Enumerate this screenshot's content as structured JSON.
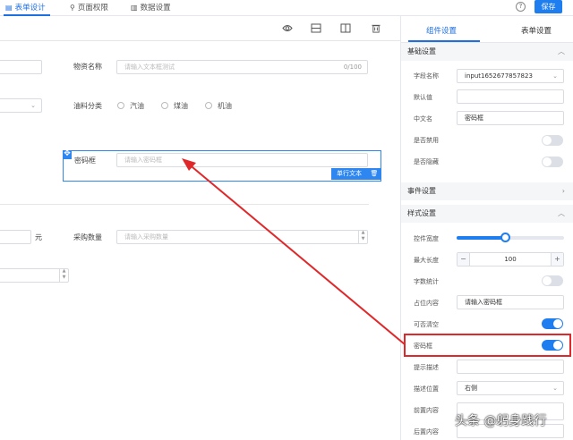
{
  "topbar": {
    "tabs": [
      {
        "label": "表单设计",
        "icon": "document-icon"
      },
      {
        "label": "页面权限",
        "icon": "lock-icon"
      },
      {
        "label": "数据设置",
        "icon": "chart-icon"
      }
    ],
    "help_icon": "?",
    "save_label": "保存"
  },
  "canvas": {
    "toolbar_icons": [
      "eye-icon",
      "split-horizontal-icon",
      "split-vertical-icon",
      "trash-icon"
    ],
    "fields": {
      "material_name_label": "物资名称",
      "material_name_placeholder": "请输入文本框测试",
      "material_name_counter": "0/100",
      "oil_label": "油料分类",
      "oil_options": [
        "汽油",
        "煤油",
        "机油"
      ],
      "password_label": "密码框",
      "password_placeholder": "请输入密码框",
      "selected_type": "单行文本",
      "unit_yuan": "元",
      "purchase_label": "采购数量",
      "purchase_placeholder": "请输入采购数量"
    }
  },
  "panel": {
    "tabs": [
      "组件设置",
      "表单设置"
    ],
    "basic_section": "基础设置",
    "event_section": "事件设置",
    "style_section": "样式设置",
    "basic": {
      "field_name_label": "字段名称",
      "field_name_value": "input1652677857823",
      "default_label": "默认值",
      "cn_name_label": "中文名",
      "cn_name_value": "密码框",
      "disabled_label": "是否禁用",
      "hidden_label": "是否隐藏"
    },
    "style": {
      "width_label": "控件宽度",
      "width_level": 0.45,
      "maxlen_label": "最大长度",
      "maxlen_value": "100",
      "minus": "−",
      "plus": "+",
      "wordcount_label": "字数统计",
      "placeholder_label": "占位内容",
      "placeholder_value": "请输入密码框",
      "clearable_label": "可否清空",
      "password_label": "密码框",
      "hint_label": "提示描述",
      "hint_pos_label": "描述位置",
      "hint_pos_value": "右侧",
      "prefix_label": "前置内容",
      "suffix_label": "后置内容"
    }
  },
  "watermark": "头条 @躬身践行",
  "colors": {
    "accent": "#1e7ef0",
    "highlight": "#e0282a"
  }
}
